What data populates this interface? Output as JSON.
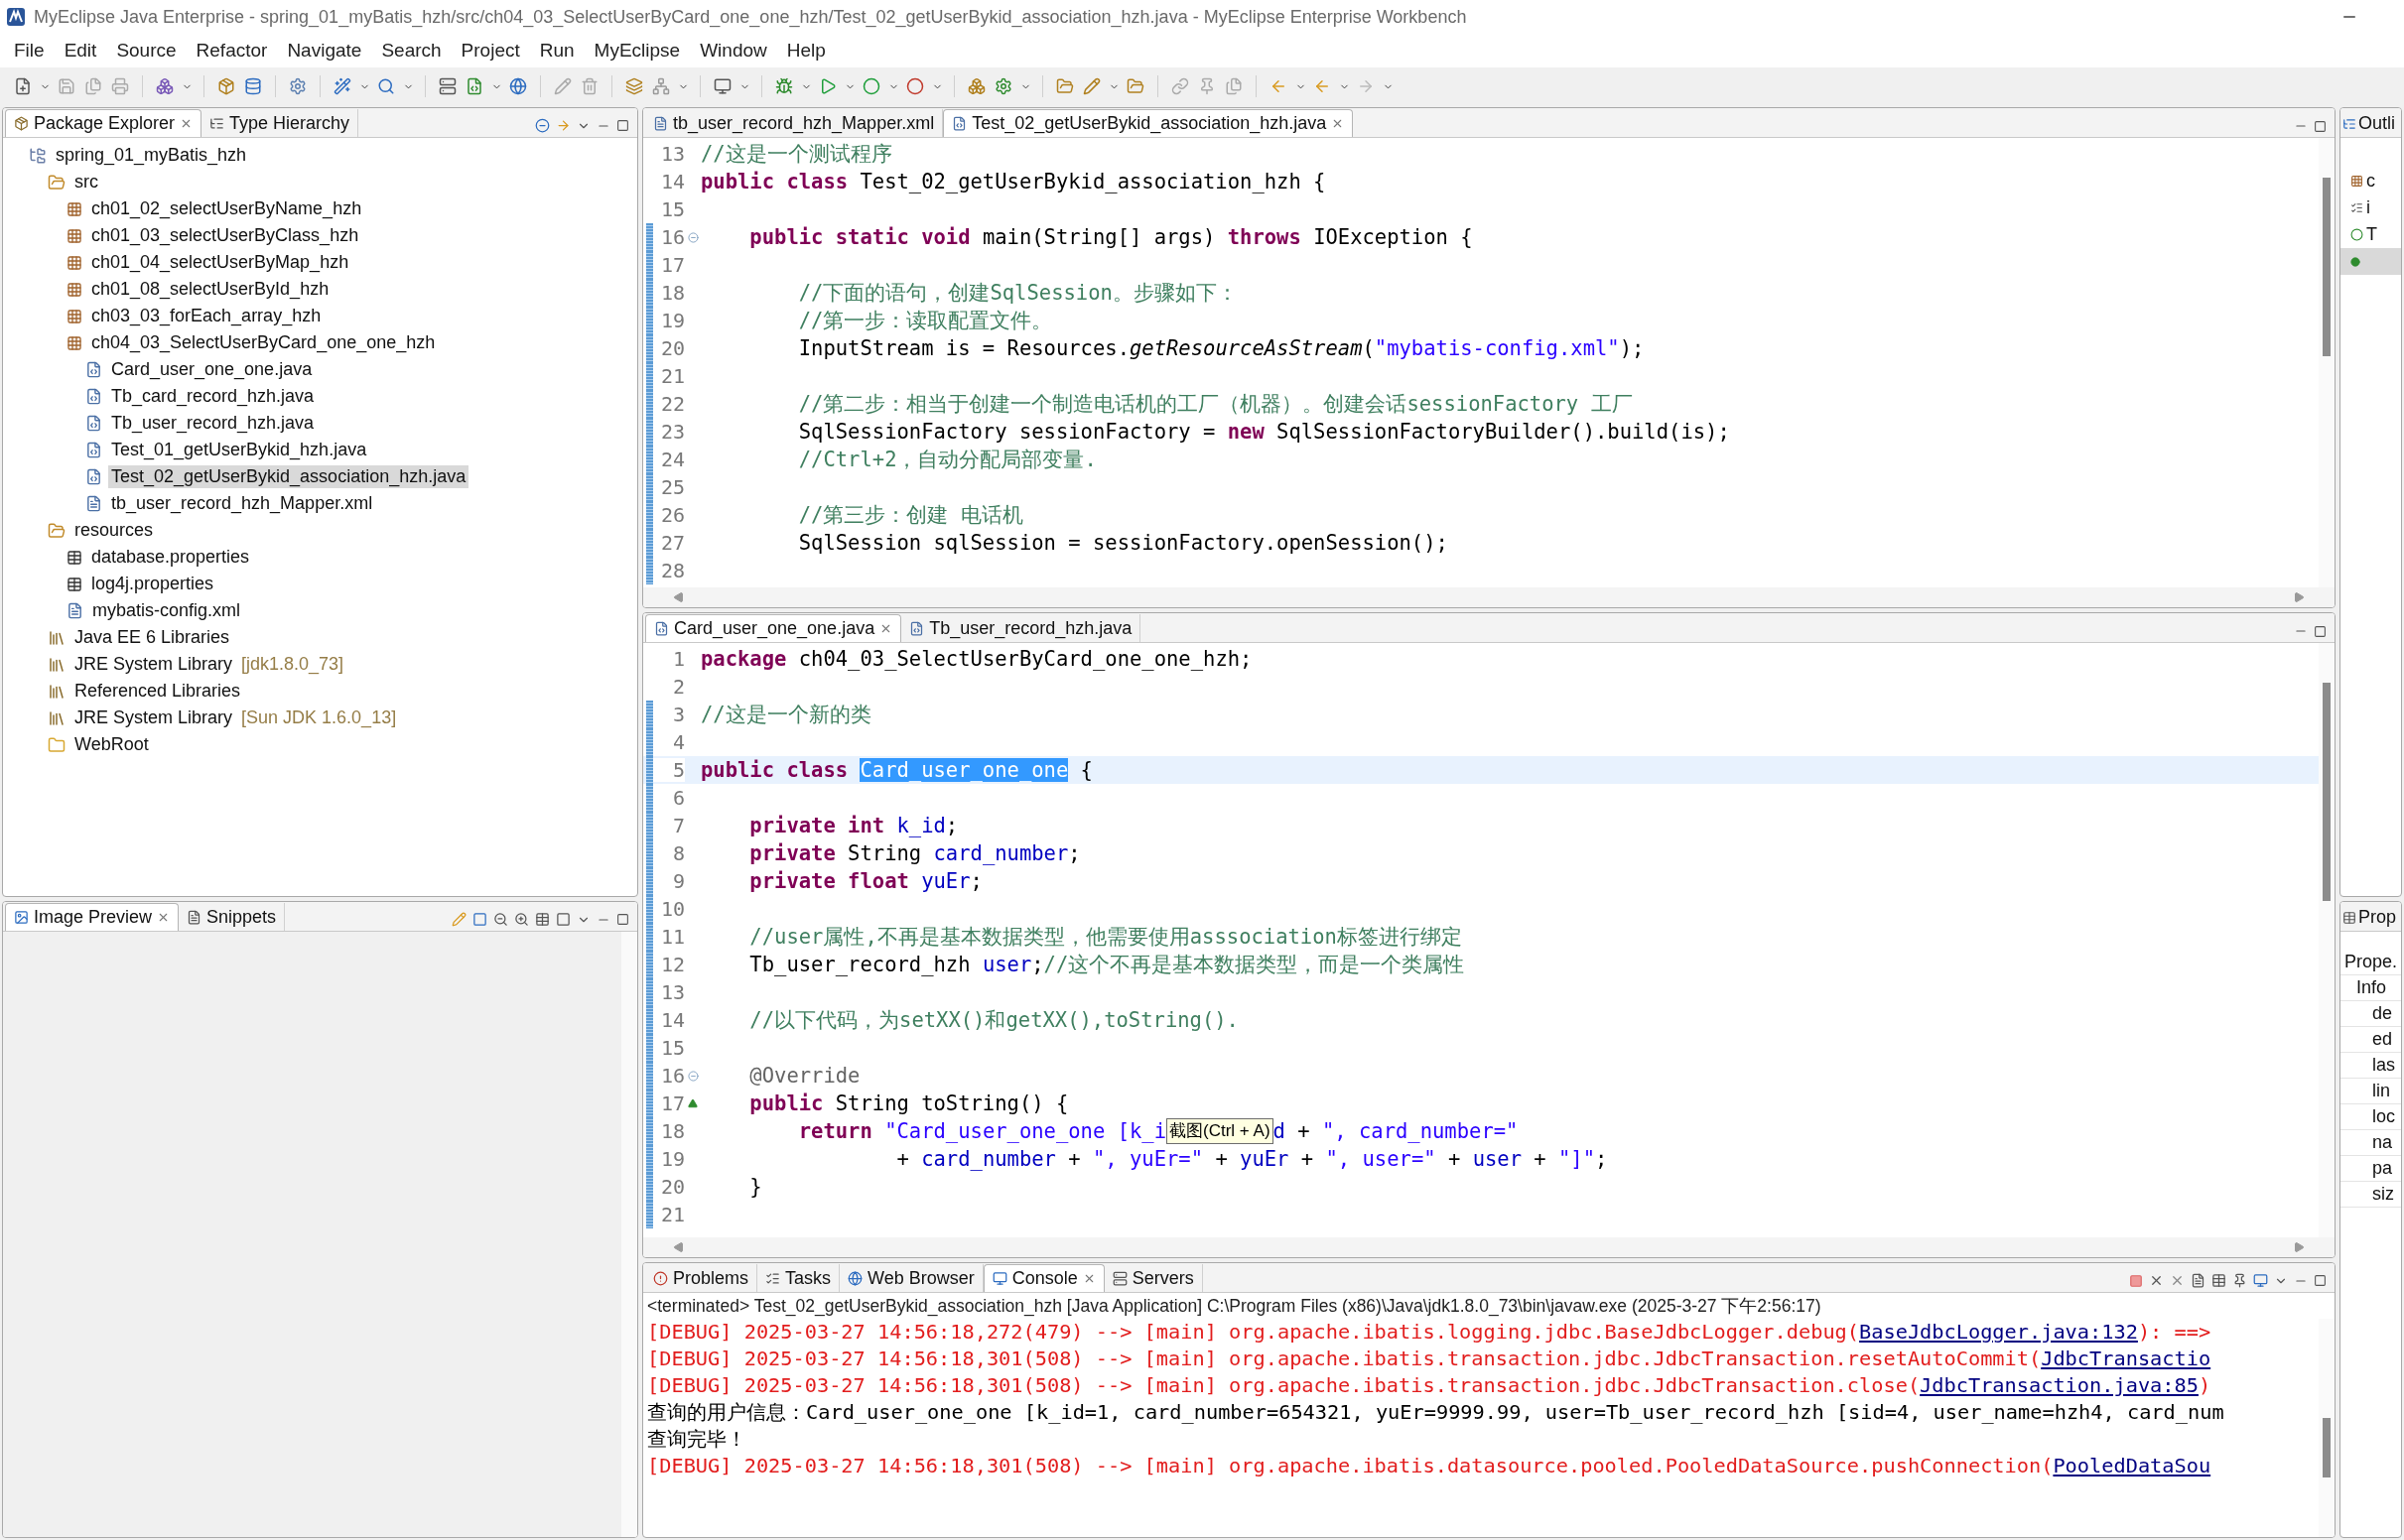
{
  "window": {
    "title": "MyEclipse Java Enterprise - spring_01_myBatis_hzh/src/ch04_03_SelectUserByCard_one_one_hzh/Test_02_getUserBykid_association_hzh.java - MyEclipse Enterprise Workbench"
  },
  "menu": [
    "File",
    "Edit",
    "Source",
    "Refactor",
    "Navigate",
    "Search",
    "Project",
    "Run",
    "MyEclipse",
    "Window",
    "Help"
  ],
  "explorer": {
    "tabs": [
      {
        "label": "Package Explorer",
        "selected": true
      },
      {
        "label": "Type Hierarchy",
        "selected": false
      }
    ],
    "tree": [
      {
        "label": "spring_01_myBatis_hzh",
        "kind": "project",
        "selected": false,
        "children": [
          {
            "label": "src",
            "kind": "source-folder",
            "selected": false,
            "children": [
              {
                "label": "ch01_02_selectUserByName_hzh",
                "kind": "package",
                "selected": false
              },
              {
                "label": "ch01_03_selectUserByClass_hzh",
                "kind": "package",
                "selected": false
              },
              {
                "label": "ch01_04_selectUserByMap_hzh",
                "kind": "package",
                "selected": false
              },
              {
                "label": "ch01_08_selectUserById_hzh",
                "kind": "package",
                "selected": false
              },
              {
                "label": "ch03_03_forEach_array_hzh",
                "kind": "package",
                "selected": false
              },
              {
                "label": "ch04_03_SelectUserByCard_one_one_hzh",
                "kind": "package",
                "selected": false,
                "children": [
                  {
                    "label": "Card_user_one_one.java",
                    "kind": "java",
                    "selected": false
                  },
                  {
                    "label": "Tb_card_record_hzh.java",
                    "kind": "java",
                    "selected": false
                  },
                  {
                    "label": "Tb_user_record_hzh.java",
                    "kind": "java",
                    "selected": false
                  },
                  {
                    "label": "Test_01_getUserBykid_hzh.java",
                    "kind": "java",
                    "selected": false
                  },
                  {
                    "label": "Test_02_getUserBykid_association_hzh.java",
                    "kind": "java",
                    "selected": true
                  },
                  {
                    "label": "tb_user_record_hzh_Mapper.xml",
                    "kind": "xml",
                    "selected": false
                  }
                ]
              }
            ]
          },
          {
            "label": "resources",
            "kind": "source-folder",
            "selected": false,
            "children": [
              {
                "label": "database.properties",
                "kind": "properties",
                "selected": false
              },
              {
                "label": "log4j.properties",
                "kind": "properties",
                "selected": false
              },
              {
                "label": "mybatis-config.xml",
                "kind": "xml",
                "selected": false
              }
            ]
          },
          {
            "label": "Java EE 6 Libraries",
            "kind": "library",
            "selected": false
          },
          {
            "label": "JRE System Library",
            "suffix": "[jdk1.8.0_73]",
            "kind": "library",
            "selected": false
          },
          {
            "label": "Referenced Libraries",
            "kind": "library",
            "selected": false
          },
          {
            "label": "JRE System Library",
            "suffix": "[Sun JDK 1.6.0_13]",
            "kind": "library",
            "selected": false
          },
          {
            "label": "WebRoot",
            "kind": "folder",
            "selected": false
          }
        ]
      }
    ]
  },
  "preview": {
    "tabs": [
      {
        "label": "Image Preview",
        "selected": true
      },
      {
        "label": "Snippets",
        "selected": false
      }
    ]
  },
  "editor_top": {
    "tabs": [
      {
        "label": "tb_user_record_hzh_Mapper.xml",
        "kind": "xml",
        "selected": false
      },
      {
        "label": "Test_02_getUserBykid_association_hzh.java",
        "kind": "java",
        "selected": true
      }
    ],
    "lines": [
      {
        "no": "13",
        "changed": false,
        "current": false,
        "segs": [
          {
            "kind": "comment",
            "text": "//这是一个测试程序"
          }
        ]
      },
      {
        "no": "14",
        "changed": false,
        "current": false,
        "segs": [
          {
            "kind": "keyword",
            "text": "public class "
          },
          {
            "kind": "plain",
            "text": "Test_02_getUserBykid_association_hzh {"
          }
        ]
      },
      {
        "no": "15",
        "changed": false,
        "current": false
      },
      {
        "no": "16",
        "changed": true,
        "current": false,
        "fold": true,
        "segs": [
          {
            "kind": "keyword",
            "text": "    public static void "
          },
          {
            "kind": "plain",
            "text": "main(String[] args) "
          },
          {
            "kind": "keyword",
            "text": "throws "
          },
          {
            "kind": "plain",
            "text": "IOException {"
          }
        ]
      },
      {
        "no": "17",
        "changed": true,
        "current": false
      },
      {
        "no": "18",
        "changed": true,
        "current": false,
        "segs": [
          {
            "kind": "comment",
            "text": "        //下面的语句，创建SqlSession。步骤如下："
          }
        ]
      },
      {
        "no": "19",
        "changed": true,
        "current": false,
        "segs": [
          {
            "kind": "comment",
            "text": "        //第一步：读取配置文件。"
          }
        ]
      },
      {
        "no": "20",
        "changed": true,
        "current": false,
        "segs": [
          {
            "kind": "plain",
            "text": "        InputStream is = Resources."
          },
          {
            "kind": "italic",
            "text": "getResourceAsStream"
          },
          {
            "kind": "plain",
            "text": "("
          },
          {
            "kind": "string",
            "text": "\"mybatis-config.xml\""
          },
          {
            "kind": "plain",
            "text": ");"
          }
        ]
      },
      {
        "no": "21",
        "changed": true,
        "current": false
      },
      {
        "no": "22",
        "changed": true,
        "current": false,
        "segs": [
          {
            "kind": "comment",
            "text": "        //第二步：相当于创建一个制造电话机的工厂（机器）。创建会话sessionFactory 工厂"
          }
        ]
      },
      {
        "no": "23",
        "changed": true,
        "current": false,
        "segs": [
          {
            "kind": "plain",
            "text": "        SqlSessionFactory sessionFactory = "
          },
          {
            "kind": "keyword",
            "text": "new "
          },
          {
            "kind": "plain",
            "text": "SqlSessionFactoryBuilder().build(is);"
          }
        ]
      },
      {
        "no": "24",
        "changed": true,
        "current": false,
        "segs": [
          {
            "kind": "comment",
            "text": "        //Ctrl+2，自动分配局部变量."
          }
        ]
      },
      {
        "no": "25",
        "changed": true,
        "current": false
      },
      {
        "no": "26",
        "changed": true,
        "current": false,
        "segs": [
          {
            "kind": "comment",
            "text": "        //第三步：创建 电话机"
          }
        ]
      },
      {
        "no": "27",
        "changed": true,
        "current": false,
        "segs": [
          {
            "kind": "plain",
            "text": "        SqlSession sqlSession = sessionFactory.openSession();"
          }
        ]
      },
      {
        "no": "28",
        "changed": true,
        "current": false
      }
    ]
  },
  "editor_bottom": {
    "tabs": [
      {
        "label": "Card_user_one_one.java",
        "kind": "java",
        "selected": true
      },
      {
        "label": "Tb_user_record_hzh.java",
        "kind": "java",
        "selected": false
      }
    ],
    "lines": [
      {
        "no": "1",
        "changed": false,
        "current": false,
        "segs": [
          {
            "kind": "keyword",
            "text": "package "
          },
          {
            "kind": "plain",
            "text": "ch04_03_SelectUserByCard_one_one_hzh;"
          }
        ]
      },
      {
        "no": "2",
        "changed": false,
        "current": false
      },
      {
        "no": "3",
        "changed": true,
        "current": false,
        "segs": [
          {
            "kind": "comment",
            "text": "//这是一个新的类"
          }
        ]
      },
      {
        "no": "4",
        "changed": true,
        "current": false
      },
      {
        "no": "5",
        "changed": true,
        "current": true,
        "segs": [
          {
            "kind": "keyword",
            "text": "public class "
          },
          {
            "kind": "selection",
            "text": "Card_user_one_one"
          },
          {
            "kind": "plain",
            "text": " {"
          }
        ]
      },
      {
        "no": "6",
        "changed": true,
        "current": false
      },
      {
        "no": "7",
        "changed": true,
        "current": false,
        "segs": [
          {
            "kind": "keyword",
            "text": "    private int "
          },
          {
            "kind": "field",
            "text": "k_id"
          },
          {
            "kind": "plain",
            "text": ";"
          }
        ]
      },
      {
        "no": "8",
        "changed": true,
        "current": false,
        "segs": [
          {
            "kind": "keyword",
            "text": "    private "
          },
          {
            "kind": "plain",
            "text": "String "
          },
          {
            "kind": "field",
            "text": "card_number"
          },
          {
            "kind": "plain",
            "text": ";"
          }
        ]
      },
      {
        "no": "9",
        "changed": true,
        "current": false,
        "segs": [
          {
            "kind": "keyword",
            "text": "    private float "
          },
          {
            "kind": "field",
            "text": "yuEr"
          },
          {
            "kind": "plain",
            "text": ";"
          }
        ]
      },
      {
        "no": "10",
        "changed": true,
        "current": false
      },
      {
        "no": "11",
        "changed": true,
        "current": false,
        "segs": [
          {
            "kind": "comment",
            "text": "    //user属性,不再是基本数据类型，他需要使用asssociation标签进行绑定"
          }
        ]
      },
      {
        "no": "12",
        "changed": true,
        "current": false,
        "segs": [
          {
            "kind": "plain",
            "text": "    Tb_user_record_hzh "
          },
          {
            "kind": "field",
            "text": "user"
          },
          {
            "kind": "plain",
            "text": ";"
          },
          {
            "kind": "comment",
            "text": "//这个不再是基本数据类型，而是一个类属性"
          }
        ]
      },
      {
        "no": "13",
        "changed": true,
        "current": false
      },
      {
        "no": "14",
        "changed": true,
        "current": false,
        "segs": [
          {
            "kind": "comment",
            "text": "    //以下代码，为setXX()和getXX(),toString()."
          }
        ]
      },
      {
        "no": "15",
        "changed": true,
        "current": false
      },
      {
        "no": "16",
        "changed": true,
        "current": false,
        "fold": true,
        "segs": [
          {
            "kind": "annotation",
            "text": "    @Override"
          }
        ]
      },
      {
        "no": "17",
        "changed": true,
        "current": false,
        "override": true,
        "segs": [
          {
            "kind": "keyword",
            "text": "    public "
          },
          {
            "kind": "plain",
            "text": "String toString() {"
          }
        ]
      },
      {
        "no": "18",
        "changed": true,
        "current": false,
        "segs": [
          {
            "kind": "keyword",
            "text": "        return "
          },
          {
            "kind": "string",
            "text": "\"Card_user_one_one [k_i"
          },
          {
            "kind": "tooltip",
            "text": "截图(Ctrl + A)"
          },
          {
            "kind": "field",
            "text": "d"
          },
          {
            "kind": "plain",
            "text": " + "
          },
          {
            "kind": "string",
            "text": "\", card_number=\""
          }
        ]
      },
      {
        "no": "19",
        "changed": true,
        "current": false,
        "segs": [
          {
            "kind": "plain",
            "text": "                + "
          },
          {
            "kind": "field",
            "text": "card_number"
          },
          {
            "kind": "plain",
            "text": " + "
          },
          {
            "kind": "string",
            "text": "\", yuEr=\""
          },
          {
            "kind": "plain",
            "text": " + "
          },
          {
            "kind": "field",
            "text": "yuEr"
          },
          {
            "kind": "plain",
            "text": " + "
          },
          {
            "kind": "string",
            "text": "\", user=\""
          },
          {
            "kind": "plain",
            "text": " + "
          },
          {
            "kind": "field",
            "text": "user"
          },
          {
            "kind": "plain",
            "text": " + "
          },
          {
            "kind": "string",
            "text": "\"]\""
          },
          {
            "kind": "plain",
            "text": ";"
          }
        ]
      },
      {
        "no": "20",
        "changed": true,
        "current": false,
        "segs": [
          {
            "kind": "plain",
            "text": "    }"
          }
        ]
      },
      {
        "no": "21",
        "changed": true,
        "current": false
      }
    ]
  },
  "console": {
    "tabs": [
      {
        "label": "Problems",
        "selected": false
      },
      {
        "label": "Tasks",
        "selected": false
      },
      {
        "label": "Web Browser",
        "selected": false
      },
      {
        "label": "Console",
        "selected": true
      },
      {
        "label": "Servers",
        "selected": false
      }
    ],
    "header": "<terminated> Test_02_getUserBykid_association_hzh [Java Application] C:\\Program Files (x86)\\Java\\jdk1.8.0_73\\bin\\javaw.exe (2025-3-27 下午2:56:17)",
    "lines": [
      {
        "kind": "error",
        "segs": [
          {
            "kind": "text",
            "text": "[DEBUG] 2025-03-27 14:56:18,272(479) --> [main] org.apache.ibatis.logging.jdbc.BaseJdbcLogger.debug("
          },
          {
            "kind": "link",
            "text": "BaseJdbcLogger.java:132"
          },
          {
            "kind": "text",
            "text": "): ==>"
          }
        ]
      },
      {
        "kind": "error",
        "segs": [
          {
            "kind": "text",
            "text": "[DEBUG] 2025-03-27 14:56:18,301(508) --> [main] org.apache.ibatis.transaction.jdbc.JdbcTransaction.resetAutoCommit("
          },
          {
            "kind": "link",
            "text": "JdbcTransactio"
          }
        ]
      },
      {
        "kind": "error",
        "segs": [
          {
            "kind": "text",
            "text": "[DEBUG] 2025-03-27 14:56:18,301(508) --> [main] org.apache.ibatis.transaction.jdbc.JdbcTransaction.close("
          },
          {
            "kind": "link",
            "text": "JdbcTransaction.java:85"
          },
          {
            "kind": "text",
            "text": ")"
          }
        ]
      },
      {
        "kind": "output",
        "segs": [
          {
            "kind": "text",
            "text": "查询的用户信息：Card_user_one_one [k_id=1, card_number=654321, yuEr=9999.99, user=Tb_user_record_hzh [sid=4, user_name=hzh4, card_num"
          }
        ]
      },
      {
        "kind": "output",
        "segs": [
          {
            "kind": "text",
            "text": "查询完毕！"
          }
        ]
      },
      {
        "kind": "error",
        "segs": [
          {
            "kind": "text",
            "text": "[DEBUG] 2025-03-27 14:56:18,301(508) --> [main] org.apache.ibatis.datasource.pooled.PooledDataSource.pushConnection("
          },
          {
            "kind": "link",
            "text": "PooledDataSou"
          }
        ]
      }
    ]
  },
  "outline": {
    "title": "Outli",
    "items": [
      {
        "label": "c",
        "kind": "package",
        "selected": false
      },
      {
        "label": "i",
        "kind": "imports",
        "selected": false
      },
      {
        "label": "T",
        "kind": "class",
        "selected": false
      },
      {
        "kind": "method",
        "selected": true
      }
    ]
  },
  "properties": {
    "title": "Prop",
    "header": "Prope.",
    "group": "Info",
    "rows": [
      "de",
      "ed",
      "las",
      "lin",
      "loc",
      "na",
      "pa",
      "siz"
    ]
  }
}
